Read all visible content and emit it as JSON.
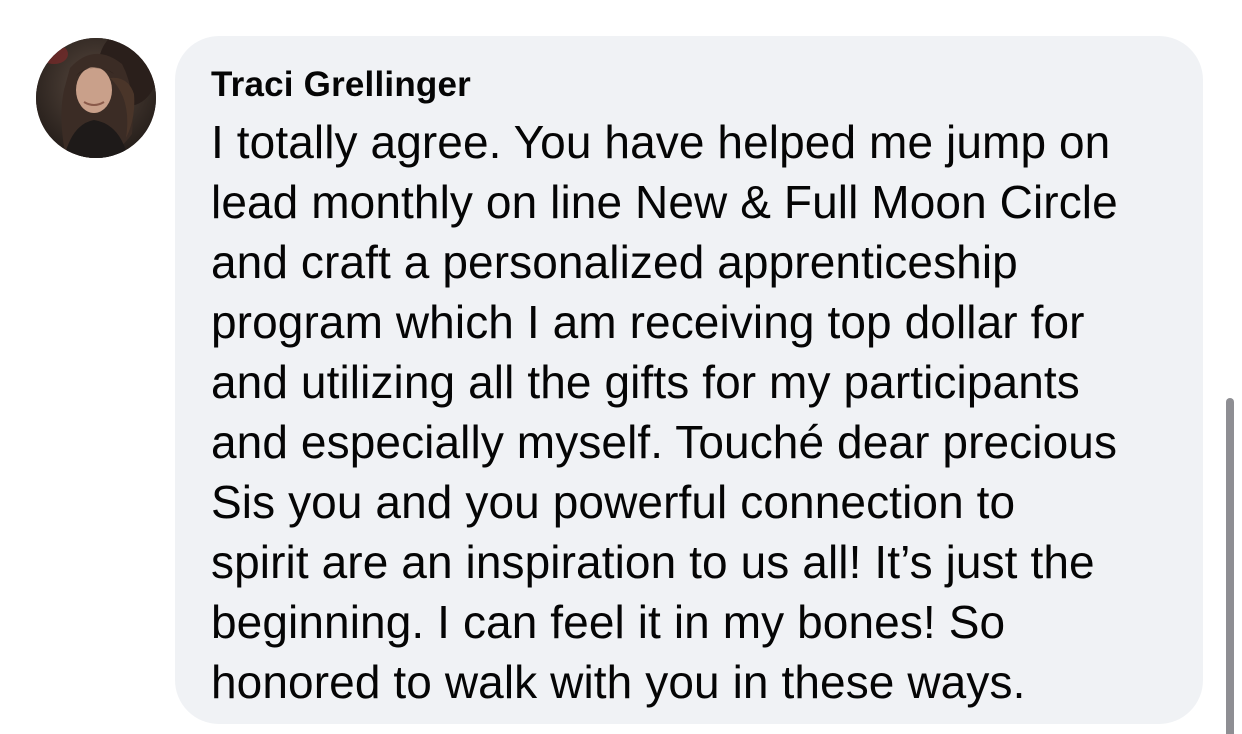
{
  "comment": {
    "author": "Traci Grellinger",
    "avatar_icon": "profile-photo",
    "lines": [
      "I totally agree. You have helped me jump on",
      "lead monthly on line New & Full Moon Circle",
      "and craft a personalized apprenticeship",
      "program which I am receiving top dollar for",
      "and utilizing all the gifts for my participants",
      "and especially myself. Touché dear precious",
      "Sis you and you powerful connection to",
      "spirit are an inspiration to us all! It’s just the",
      "beginning. I can feel it in my bones! So",
      "honored to walk with you in these ways."
    ]
  },
  "colors": {
    "bubble": "#f0f2f5",
    "text": "#050505",
    "scrollbar": "#8e8e93"
  }
}
